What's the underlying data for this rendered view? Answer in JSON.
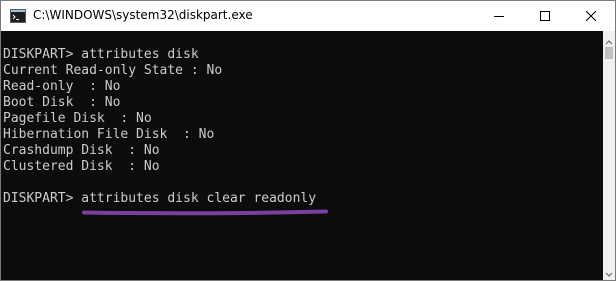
{
  "window": {
    "title": "C:\\WINDOWS\\system32\\diskpart.exe"
  },
  "titlebar_icons": {
    "app": "console-app-icon",
    "minimize": "minimize-icon",
    "maximize": "maximize-icon",
    "close": "close-icon"
  },
  "console": {
    "lines": [
      "",
      "DISKPART> attributes disk",
      "Current Read-only State : No",
      "Read-only  : No",
      "Boot Disk  : No",
      "Pagefile Disk  : No",
      "Hibernation File Disk  : No",
      "Crashdump Disk  : No",
      "Clustered Disk  : No",
      "",
      "DISKPART> attributes disk clear readonly"
    ],
    "highlight_color": "#7b3fa0"
  },
  "colors": {
    "console_background": "#0c0c0c",
    "console_text": "#cccccc",
    "annotation_underline": "#7b3fa0"
  }
}
